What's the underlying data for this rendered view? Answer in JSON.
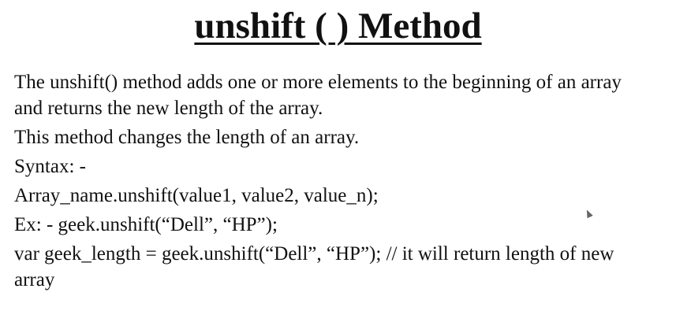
{
  "slide": {
    "title": "unshift ( ) Method",
    "lines": [
      "The unshift() method adds one or more elements to the beginning of an array",
      "and returns the new length of the array.",
      "This method changes the length of an array.",
      "Syntax: -",
      "Array_name.unshift(value1, value2, value_n);",
      "Ex: - geek.unshift(“Dell”, “HP”);",
      "var geek_length = geek.unshift(“Dell”, “HP”);  // it will return length of new",
      "array"
    ],
    "cursor_icon": "mouse-pointer-icon"
  }
}
